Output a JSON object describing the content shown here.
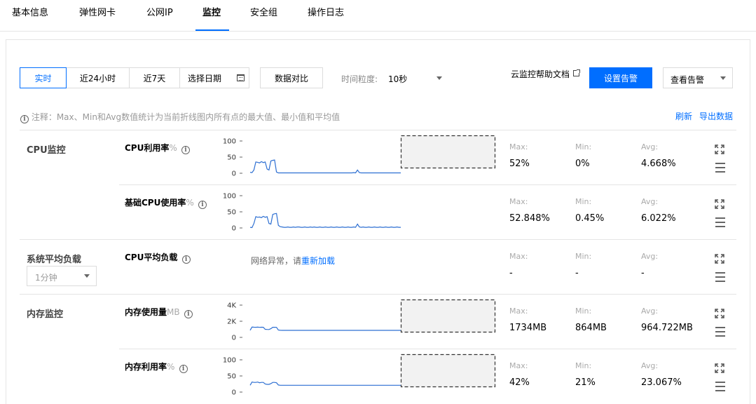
{
  "tabs": [
    {
      "label": "基本信息",
      "active": false
    },
    {
      "label": "弹性网卡",
      "active": false
    },
    {
      "label": "公网IP",
      "active": false
    },
    {
      "label": "监控",
      "active": true
    },
    {
      "label": "安全组",
      "active": false
    },
    {
      "label": "操作日志",
      "active": false
    }
  ],
  "toolbar": {
    "range_buttons": [
      "实时",
      "近24小时",
      "近7天"
    ],
    "date_picker_label": "选择日期",
    "compare_button": "数据对比",
    "granularity_label": "时间粒度:",
    "granularity_value": "10秒",
    "help_link": "云监控帮助文档",
    "set_alarm_button": "设置告警",
    "view_alarm_select": "查看告警"
  },
  "note": {
    "text": "注释：Max、Min和Avg数值统计为当前折线图内所有点的最大值、最小值和平均值",
    "refresh": "刷新",
    "export": "导出数据"
  },
  "stat_labels": {
    "max": "Max:",
    "min": "Min:",
    "avg": "Avg:"
  },
  "groups": {
    "cpu": "CPU监控",
    "load": "系统平均负载",
    "load_select": "1分钟",
    "memory": "内存监控"
  },
  "network_error": {
    "text": "网络异常，请",
    "link": "重新加载"
  },
  "metrics": [
    {
      "title": "CPU利用率",
      "unit": "%",
      "max": "52%",
      "min": "0%",
      "avg": "4.668%"
    },
    {
      "title": "基础CPU使用率",
      "unit": "%",
      "max": "52.848%",
      "min": "0.45%",
      "avg": "6.022%"
    },
    {
      "title": "CPU平均负载",
      "unit": "",
      "max": "-",
      "min": "-",
      "avg": "-"
    },
    {
      "title": "内存使用量",
      "unit": "MB",
      "max": "1734MB",
      "min": "864MB",
      "avg": "964.722MB"
    },
    {
      "title": "内存利用率",
      "unit": "%",
      "max": "42%",
      "min": "21%",
      "avg": "23.067%"
    }
  ],
  "chart_data": [
    {
      "type": "line",
      "title": "CPU利用率",
      "y_ticks": [
        "100",
        "50",
        "0"
      ],
      "ylim": [
        0,
        100
      ],
      "series": [
        {
          "values": [
            3,
            2,
            10,
            35,
            34,
            32,
            36,
            33,
            35,
            13,
            10,
            38,
            40,
            41,
            4,
            1,
            1,
            1,
            1,
            1,
            1,
            1,
            1,
            1,
            1,
            1,
            1,
            1,
            1,
            1,
            1,
            1,
            1,
            1,
            1,
            1,
            1,
            1,
            1,
            1,
            1,
            1,
            1,
            1,
            1,
            1,
            1,
            1,
            1,
            1,
            1,
            1,
            1,
            1,
            1,
            2,
            1,
            10,
            2,
            1,
            1,
            1,
            1,
            1,
            1,
            1,
            1,
            1,
            1,
            1,
            1,
            1,
            1,
            1,
            1,
            1,
            1,
            1,
            1,
            1,
            1
          ]
        }
      ],
      "color": "#2d6fd2"
    },
    {
      "type": "line",
      "title": "基础CPU使用率",
      "y_ticks": [
        "100",
        "50",
        "0"
      ],
      "ylim": [
        0,
        100
      ],
      "series": [
        {
          "values": [
            2,
            1,
            14,
            35,
            33,
            34,
            32,
            36,
            33,
            35,
            14,
            12,
            42,
            44,
            45,
            8,
            4,
            3,
            2,
            2,
            3,
            2,
            2,
            3,
            2,
            3,
            3,
            2,
            2,
            3,
            2,
            2,
            3,
            2,
            3,
            2,
            2,
            3,
            2,
            2,
            3,
            2,
            2,
            3,
            2,
            2,
            3,
            2,
            2,
            3,
            2,
            2,
            3,
            2,
            2,
            3,
            2,
            12,
            3,
            2,
            3,
            2,
            2,
            3,
            2,
            2,
            3,
            2,
            2,
            3,
            2,
            2,
            3,
            2,
            2,
            3,
            2,
            2,
            3,
            2,
            2
          ]
        }
      ],
      "color": "#2d6fd2"
    },
    {
      "type": "line",
      "title": "内存使用量",
      "y_ticks": [
        "4K",
        "2K",
        "0"
      ],
      "ylim": [
        0,
        4000
      ],
      "series": [
        {
          "values": [
            880,
            1280,
            1260,
            1250,
            1270,
            1240,
            1260,
            1250,
            1000,
            980,
            970,
            1080,
            1250,
            1250,
            1240,
            900,
            880,
            870,
            870,
            870,
            870,
            870,
            870,
            870,
            870,
            870,
            870,
            870,
            870,
            870,
            870,
            870,
            870,
            870,
            870,
            870,
            870,
            870,
            870,
            870,
            870,
            870,
            870,
            870,
            870,
            870,
            870,
            870,
            870,
            870,
            870,
            870,
            870,
            870,
            870,
            870,
            870,
            870,
            870,
            870,
            870,
            870,
            870,
            870,
            870,
            870,
            870,
            870,
            870,
            870,
            870,
            870,
            870,
            870,
            870,
            870,
            870,
            870,
            870,
            870,
            870
          ]
        }
      ],
      "color": "#2d6fd2"
    },
    {
      "type": "line",
      "title": "内存利用率",
      "y_ticks": [
        "100",
        "50",
        "0"
      ],
      "ylim": [
        0,
        100
      ],
      "series": [
        {
          "values": [
            21,
            31,
            30,
            30,
            31,
            29,
            30,
            30,
            25,
            24,
            24,
            26,
            30,
            30,
            29,
            22,
            21,
            21,
            21,
            21,
            21,
            21,
            21,
            21,
            21,
            21,
            21,
            21,
            21,
            21,
            21,
            21,
            21,
            21,
            21,
            21,
            21,
            21,
            21,
            21,
            21,
            21,
            21,
            21,
            21,
            21,
            21,
            21,
            21,
            21,
            21,
            21,
            21,
            21,
            21,
            21,
            21,
            21,
            21,
            21,
            21,
            21,
            21,
            21,
            21,
            21,
            21,
            21,
            21,
            21,
            21,
            21,
            21,
            21,
            21,
            21,
            21,
            21,
            21,
            21,
            21
          ]
        }
      ],
      "color": "#2d6fd2"
    }
  ]
}
